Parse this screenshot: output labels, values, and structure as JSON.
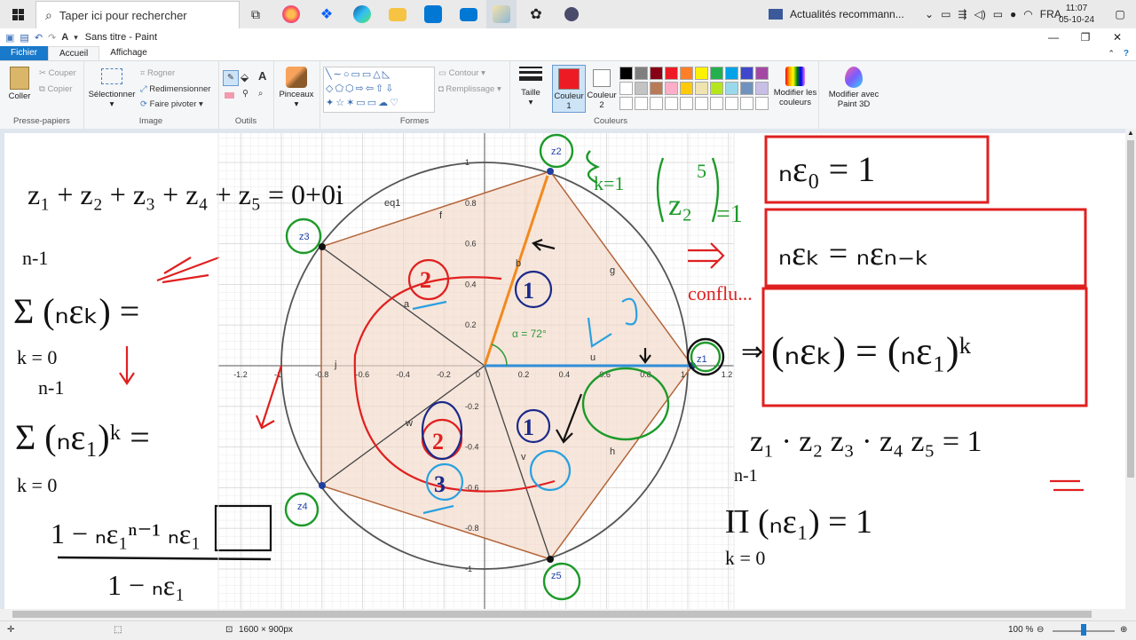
{
  "taskbar": {
    "search_placeholder": "Taper ici pour rechercher",
    "news_label": "Actualités recommann...",
    "language": "FRA",
    "time": "11:07",
    "date": "05-10-24"
  },
  "window": {
    "title": "Sans titre - Paint"
  },
  "ribbon_tabs": [
    "Fichier",
    "Accueil",
    "Affichage"
  ],
  "ribbon": {
    "clipboard": {
      "paste": "Coller",
      "cut": "Couper",
      "copy": "Copier",
      "group": "Presse-papiers"
    },
    "image": {
      "select": "Sélectionner",
      "crop": "Rogner",
      "resize": "Redimensionner",
      "rotate": "Faire pivoter",
      "group": "Image"
    },
    "tools": {
      "brushes": "Pinceaux",
      "group": "Outils"
    },
    "shapes": {
      "outline": "Contour",
      "fill": "Remplissage",
      "group": "Formes"
    },
    "size": "Taille",
    "color1": "Couleur 1",
    "color2": "Couleur 2",
    "colors_group": "Couleurs",
    "edit_colors": "Modifier les couleurs",
    "paint3d": "Modifier avec Paint 3D"
  },
  "palette": [
    "#000000",
    "#7f7f7f",
    "#880015",
    "#ed1c24",
    "#ff7f27",
    "#fff200",
    "#22b14c",
    "#00a2e8",
    "#3f48cc",
    "#a349a4",
    "#ffffff",
    "#c3c3c3",
    "#b97a57",
    "#ffaec9",
    "#ffc90e",
    "#efe4b0",
    "#b5e61d",
    "#99d9ea",
    "#7092be",
    "#c8bfe7"
  ],
  "colors": {
    "color1": "#ed1c24",
    "color2": "#ffffff"
  },
  "canvas": {
    "graph_labels": {
      "eq1": "eq1",
      "alpha": "α = 72°",
      "z1": "z1",
      "z2": "z2",
      "z3": "z3",
      "z4": "z4",
      "z5": "z5",
      "f": "f",
      "g": "g",
      "h": "h",
      "i": "i",
      "j": "j",
      "u": "u",
      "v": "v",
      "w": "w",
      "a": "a",
      "b": "b"
    },
    "x_ticks": [
      "-1.2",
      "-1",
      "-0.8",
      "-0.6",
      "-0.4",
      "-0.2",
      "0",
      "0.2",
      "0.4",
      "0.6",
      "0.8",
      "1",
      "1.2"
    ],
    "y_ticks": [
      "1",
      "0.8",
      "0.6",
      "0.4",
      "0.2",
      "-0.2",
      "-0.4",
      "-0.6",
      "-0.8",
      "-1"
    ],
    "handwriting": {
      "sum_eq": "z₁ + z₂ + z₃ + z₄ + z₅ = 0+0i",
      "sum_lhs_top": "n-1",
      "sum_lhs_body": "Σ (ₙεₖ) =",
      "sum_lhs_bottom": "k = 0",
      "sum2_top": "n-1",
      "sum2_body": "Σ (ₙε₁)ᵏ =",
      "sum2_bottom": "k = 0",
      "frac_num": "1 − ₙε₁ⁿ⁻¹ ₙε₁",
      "frac_den": "1 − ₙε₁",
      "z2_note": "Σ k=1 (z₂⁵) = 1",
      "box1": "ₙε₀ = 1",
      "box2": "ₙεₖ = ₙεₙ₋ₖ",
      "box3": "(ₙεₖ) = (ₙε₁)ᵏ",
      "note_red": "conflu...",
      "prod_eq": "z₁ · z₂ z₃ · z₄ z₅ = 1",
      "prod_top": "n-1",
      "prod_body": "Π (ₙε₁) = 1",
      "prod_bottom": "k = 0",
      "phi": "φ",
      "n1": "1",
      "n2": "2",
      "n3": "3"
    }
  },
  "status": {
    "dimensions": "1600 × 900px",
    "zoom": "100 %"
  }
}
